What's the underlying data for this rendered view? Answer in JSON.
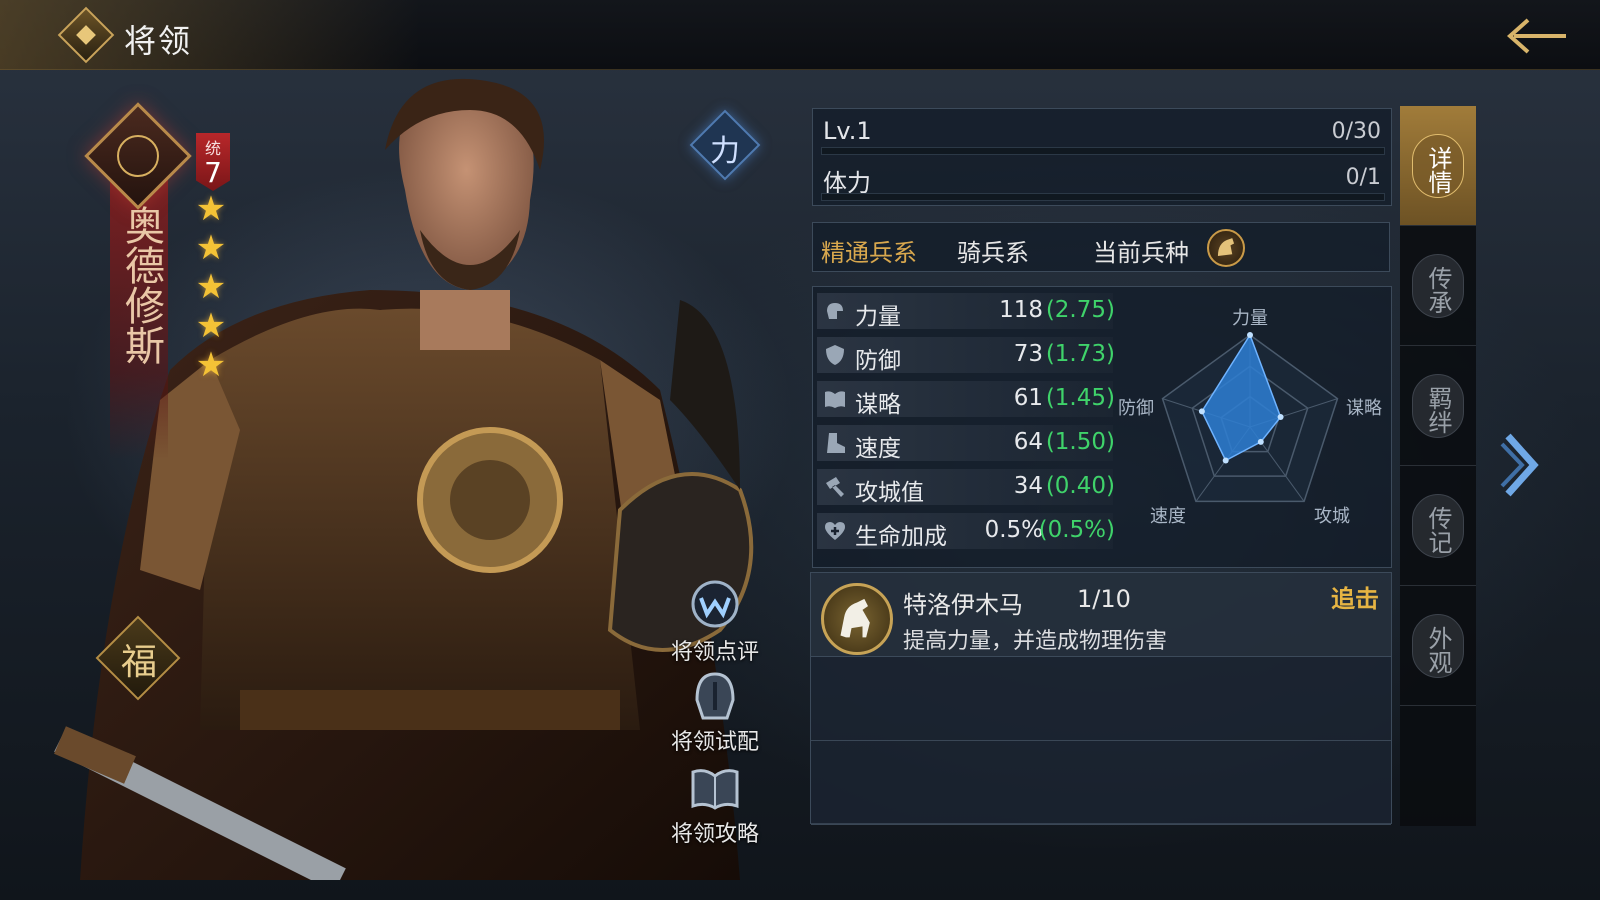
{
  "header": {
    "title": "将领"
  },
  "hero": {
    "name": "奥德修斯",
    "command_label": "统",
    "command_value": "7",
    "stars": 5,
    "fortune": "福",
    "attribute_badge": "力"
  },
  "side_actions": [
    {
      "label": "将领点评",
      "icon": "review-icon"
    },
    {
      "label": "将领试配",
      "icon": "helmet-icon"
    },
    {
      "label": "将领攻略",
      "icon": "book-icon"
    }
  ],
  "level": {
    "label": "Lv.1",
    "value": "0/30",
    "progress": 0
  },
  "stamina": {
    "label": "体力",
    "value": "0/1",
    "progress": 0
  },
  "troop": {
    "label": "精通兵系",
    "value": "骑兵系",
    "current_label": "当前兵种",
    "current_icon": "horse-icon"
  },
  "stats": [
    {
      "name": "力量",
      "value": "118",
      "growth": "(2.75)",
      "icon": "fist-icon"
    },
    {
      "name": "防御",
      "value": "73",
      "growth": "(1.73)",
      "icon": "shield-icon"
    },
    {
      "name": "谋略",
      "value": "61",
      "growth": "(1.45)",
      "icon": "book-icon"
    },
    {
      "name": "速度",
      "value": "64",
      "growth": "(1.50)",
      "icon": "boot-icon"
    },
    {
      "name": "攻城值",
      "value": "34",
      "growth": "(0.40)",
      "icon": "hammer-icon"
    },
    {
      "name": "生命加成",
      "value": "0.5%",
      "growth": "(0.5%)",
      "icon": "heart-icon"
    }
  ],
  "radar": {
    "labels": [
      "力量",
      "谋略",
      "攻城",
      "速度",
      "防御"
    ],
    "values": [
      1.0,
      0.35,
      0.2,
      0.45,
      0.55
    ]
  },
  "skill": {
    "name": "特洛伊木马",
    "level": "1/10",
    "description": "提高力量，并造成物理伤害",
    "type": "追击",
    "icon": "horse-icon"
  },
  "tabs": [
    {
      "label": "详情",
      "active": true
    },
    {
      "label": "传承",
      "active": false
    },
    {
      "label": "羁绊",
      "active": false
    },
    {
      "label": "传记",
      "active": false
    },
    {
      "label": "外观",
      "active": false
    }
  ],
  "colors": {
    "accent": "#d4a64a",
    "growth": "#3fd36a",
    "skill_type": "#e6b443",
    "radar_fill": "#2e7fd4"
  }
}
